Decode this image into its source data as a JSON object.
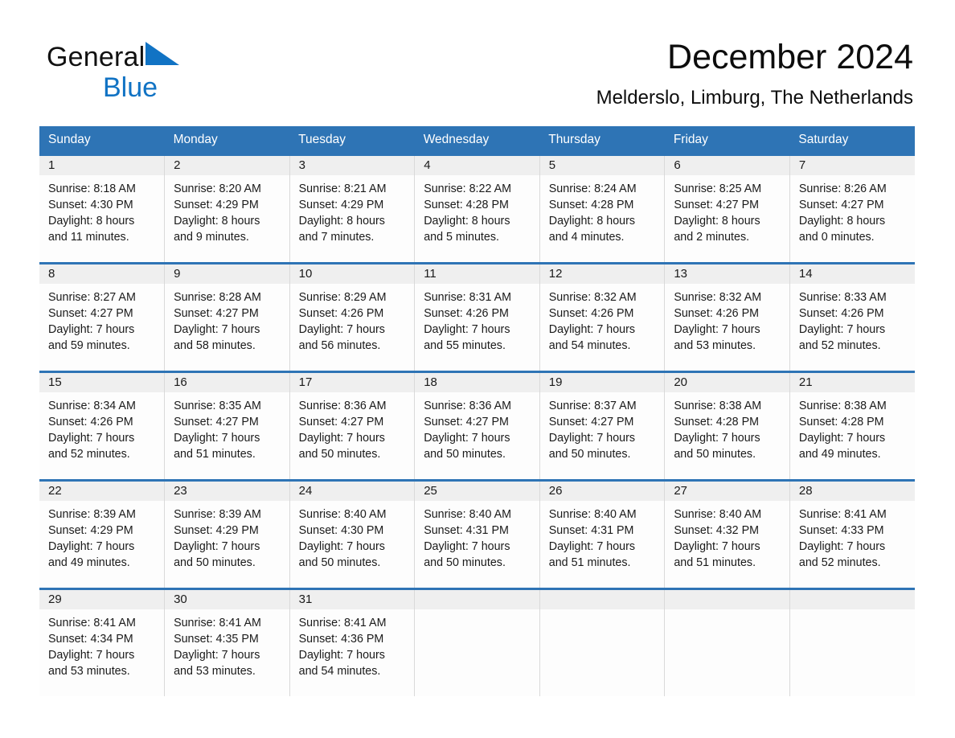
{
  "logo": {
    "word1": "General",
    "word2": "Blue",
    "triangle_color": "#1173c4",
    "blue_text_color": "#1173c4"
  },
  "header": {
    "title": "December 2024",
    "subtitle": "Melderslo, Limburg, The Netherlands"
  },
  "theme": {
    "header_blue": "#2e74b5",
    "date_band_gray": "#efefef",
    "cell_white": "#fdfdfd",
    "grid_gray": "#d9d9d9"
  },
  "weekdays": [
    "Sunday",
    "Monday",
    "Tuesday",
    "Wednesday",
    "Thursday",
    "Friday",
    "Saturday"
  ],
  "weeks": [
    [
      {
        "date": "1",
        "sunrise": "Sunrise: 8:18 AM",
        "sunset": "Sunset: 4:30 PM",
        "daylight1": "Daylight: 8 hours",
        "daylight2": "and 11 minutes."
      },
      {
        "date": "2",
        "sunrise": "Sunrise: 8:20 AM",
        "sunset": "Sunset: 4:29 PM",
        "daylight1": "Daylight: 8 hours",
        "daylight2": "and 9 minutes."
      },
      {
        "date": "3",
        "sunrise": "Sunrise: 8:21 AM",
        "sunset": "Sunset: 4:29 PM",
        "daylight1": "Daylight: 8 hours",
        "daylight2": "and 7 minutes."
      },
      {
        "date": "4",
        "sunrise": "Sunrise: 8:22 AM",
        "sunset": "Sunset: 4:28 PM",
        "daylight1": "Daylight: 8 hours",
        "daylight2": "and 5 minutes."
      },
      {
        "date": "5",
        "sunrise": "Sunrise: 8:24 AM",
        "sunset": "Sunset: 4:28 PM",
        "daylight1": "Daylight: 8 hours",
        "daylight2": "and 4 minutes."
      },
      {
        "date": "6",
        "sunrise": "Sunrise: 8:25 AM",
        "sunset": "Sunset: 4:27 PM",
        "daylight1": "Daylight: 8 hours",
        "daylight2": "and 2 minutes."
      },
      {
        "date": "7",
        "sunrise": "Sunrise: 8:26 AM",
        "sunset": "Sunset: 4:27 PM",
        "daylight1": "Daylight: 8 hours",
        "daylight2": "and 0 minutes."
      }
    ],
    [
      {
        "date": "8",
        "sunrise": "Sunrise: 8:27 AM",
        "sunset": "Sunset: 4:27 PM",
        "daylight1": "Daylight: 7 hours",
        "daylight2": "and 59 minutes."
      },
      {
        "date": "9",
        "sunrise": "Sunrise: 8:28 AM",
        "sunset": "Sunset: 4:27 PM",
        "daylight1": "Daylight: 7 hours",
        "daylight2": "and 58 minutes."
      },
      {
        "date": "10",
        "sunrise": "Sunrise: 8:29 AM",
        "sunset": "Sunset: 4:26 PM",
        "daylight1": "Daylight: 7 hours",
        "daylight2": "and 56 minutes."
      },
      {
        "date": "11",
        "sunrise": "Sunrise: 8:31 AM",
        "sunset": "Sunset: 4:26 PM",
        "daylight1": "Daylight: 7 hours",
        "daylight2": "and 55 minutes."
      },
      {
        "date": "12",
        "sunrise": "Sunrise: 8:32 AM",
        "sunset": "Sunset: 4:26 PM",
        "daylight1": "Daylight: 7 hours",
        "daylight2": "and 54 minutes."
      },
      {
        "date": "13",
        "sunrise": "Sunrise: 8:32 AM",
        "sunset": "Sunset: 4:26 PM",
        "daylight1": "Daylight: 7 hours",
        "daylight2": "and 53 minutes."
      },
      {
        "date": "14",
        "sunrise": "Sunrise: 8:33 AM",
        "sunset": "Sunset: 4:26 PM",
        "daylight1": "Daylight: 7 hours",
        "daylight2": "and 52 minutes."
      }
    ],
    [
      {
        "date": "15",
        "sunrise": "Sunrise: 8:34 AM",
        "sunset": "Sunset: 4:26 PM",
        "daylight1": "Daylight: 7 hours",
        "daylight2": "and 52 minutes."
      },
      {
        "date": "16",
        "sunrise": "Sunrise: 8:35 AM",
        "sunset": "Sunset: 4:27 PM",
        "daylight1": "Daylight: 7 hours",
        "daylight2": "and 51 minutes."
      },
      {
        "date": "17",
        "sunrise": "Sunrise: 8:36 AM",
        "sunset": "Sunset: 4:27 PM",
        "daylight1": "Daylight: 7 hours",
        "daylight2": "and 50 minutes."
      },
      {
        "date": "18",
        "sunrise": "Sunrise: 8:36 AM",
        "sunset": "Sunset: 4:27 PM",
        "daylight1": "Daylight: 7 hours",
        "daylight2": "and 50 minutes."
      },
      {
        "date": "19",
        "sunrise": "Sunrise: 8:37 AM",
        "sunset": "Sunset: 4:27 PM",
        "daylight1": "Daylight: 7 hours",
        "daylight2": "and 50 minutes."
      },
      {
        "date": "20",
        "sunrise": "Sunrise: 8:38 AM",
        "sunset": "Sunset: 4:28 PM",
        "daylight1": "Daylight: 7 hours",
        "daylight2": "and 50 minutes."
      },
      {
        "date": "21",
        "sunrise": "Sunrise: 8:38 AM",
        "sunset": "Sunset: 4:28 PM",
        "daylight1": "Daylight: 7 hours",
        "daylight2": "and 49 minutes."
      }
    ],
    [
      {
        "date": "22",
        "sunrise": "Sunrise: 8:39 AM",
        "sunset": "Sunset: 4:29 PM",
        "daylight1": "Daylight: 7 hours",
        "daylight2": "and 49 minutes."
      },
      {
        "date": "23",
        "sunrise": "Sunrise: 8:39 AM",
        "sunset": "Sunset: 4:29 PM",
        "daylight1": "Daylight: 7 hours",
        "daylight2": "and 50 minutes."
      },
      {
        "date": "24",
        "sunrise": "Sunrise: 8:40 AM",
        "sunset": "Sunset: 4:30 PM",
        "daylight1": "Daylight: 7 hours",
        "daylight2": "and 50 minutes."
      },
      {
        "date": "25",
        "sunrise": "Sunrise: 8:40 AM",
        "sunset": "Sunset: 4:31 PM",
        "daylight1": "Daylight: 7 hours",
        "daylight2": "and 50 minutes."
      },
      {
        "date": "26",
        "sunrise": "Sunrise: 8:40 AM",
        "sunset": "Sunset: 4:31 PM",
        "daylight1": "Daylight: 7 hours",
        "daylight2": "and 51 minutes."
      },
      {
        "date": "27",
        "sunrise": "Sunrise: 8:40 AM",
        "sunset": "Sunset: 4:32 PM",
        "daylight1": "Daylight: 7 hours",
        "daylight2": "and 51 minutes."
      },
      {
        "date": "28",
        "sunrise": "Sunrise: 8:41 AM",
        "sunset": "Sunset: 4:33 PM",
        "daylight1": "Daylight: 7 hours",
        "daylight2": "and 52 minutes."
      }
    ],
    [
      {
        "date": "29",
        "sunrise": "Sunrise: 8:41 AM",
        "sunset": "Sunset: 4:34 PM",
        "daylight1": "Daylight: 7 hours",
        "daylight2": "and 53 minutes."
      },
      {
        "date": "30",
        "sunrise": "Sunrise: 8:41 AM",
        "sunset": "Sunset: 4:35 PM",
        "daylight1": "Daylight: 7 hours",
        "daylight2": "and 53 minutes."
      },
      {
        "date": "31",
        "sunrise": "Sunrise: 8:41 AM",
        "sunset": "Sunset: 4:36 PM",
        "daylight1": "Daylight: 7 hours",
        "daylight2": "and 54 minutes."
      },
      {
        "date": "",
        "sunrise": "",
        "sunset": "",
        "daylight1": "",
        "daylight2": ""
      },
      {
        "date": "",
        "sunrise": "",
        "sunset": "",
        "daylight1": "",
        "daylight2": ""
      },
      {
        "date": "",
        "sunrise": "",
        "sunset": "",
        "daylight1": "",
        "daylight2": ""
      },
      {
        "date": "",
        "sunrise": "",
        "sunset": "",
        "daylight1": "",
        "daylight2": ""
      }
    ]
  ]
}
